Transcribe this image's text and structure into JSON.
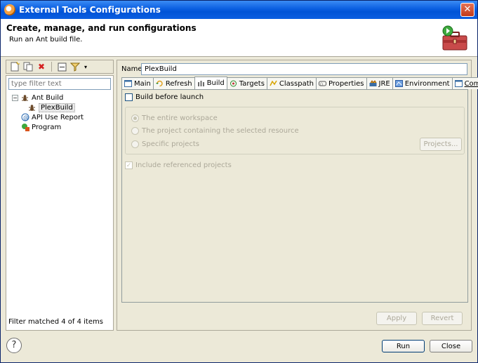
{
  "window": {
    "title": "External Tools Configurations"
  },
  "header": {
    "title": "Create, manage, and run configurations",
    "subtitle": "Run an Ant build file."
  },
  "left": {
    "toolbar": {
      "new_icon": "new-config-icon",
      "duplicate_icon": "duplicate-icon",
      "delete_icon": "delete-icon",
      "collapse_icon": "collapse-all-icon",
      "filter_icon": "filter-icon"
    },
    "filter_placeholder": "type filter text",
    "tree": [
      {
        "label": "Ant Build",
        "expanded": true,
        "icon": "ant-icon"
      },
      {
        "label": "PlexBuild",
        "child": true,
        "selected": true,
        "icon": "ant-icon"
      },
      {
        "label": "API Use Report",
        "icon": "api-report-icon"
      },
      {
        "label": "Program",
        "icon": "program-icon"
      }
    ],
    "status": "Filter matched 4 of 4 items"
  },
  "right": {
    "name_label": "Name:",
    "name_value": "PlexBuild",
    "tabs": [
      {
        "label": "Main",
        "icon": "main-icon"
      },
      {
        "label": "Refresh",
        "icon": "refresh-icon"
      },
      {
        "label": "Build",
        "icon": "build-icon",
        "active": true
      },
      {
        "label": "Targets",
        "icon": "targets-icon"
      },
      {
        "label": "Classpath",
        "icon": "classpath-icon"
      },
      {
        "label": "Properties",
        "icon": "properties-icon"
      },
      {
        "label": "JRE",
        "icon": "jre-icon"
      },
      {
        "label": "Environment",
        "icon": "environment-icon"
      },
      {
        "label": "Common",
        "icon": "common-icon"
      }
    ],
    "build_before_launch": "Build before launch",
    "radios": {
      "entire_workspace": "The entire workspace",
      "project_selected": "The project containing the selected resource",
      "specific_projects": "Specific projects"
    },
    "projects_button": "Projects...",
    "include_referenced": "Include referenced projects",
    "apply_button": "Apply",
    "revert_button": "Revert"
  },
  "footer": {
    "help_label": "?",
    "run_button": "Run",
    "close_button": "Close"
  }
}
